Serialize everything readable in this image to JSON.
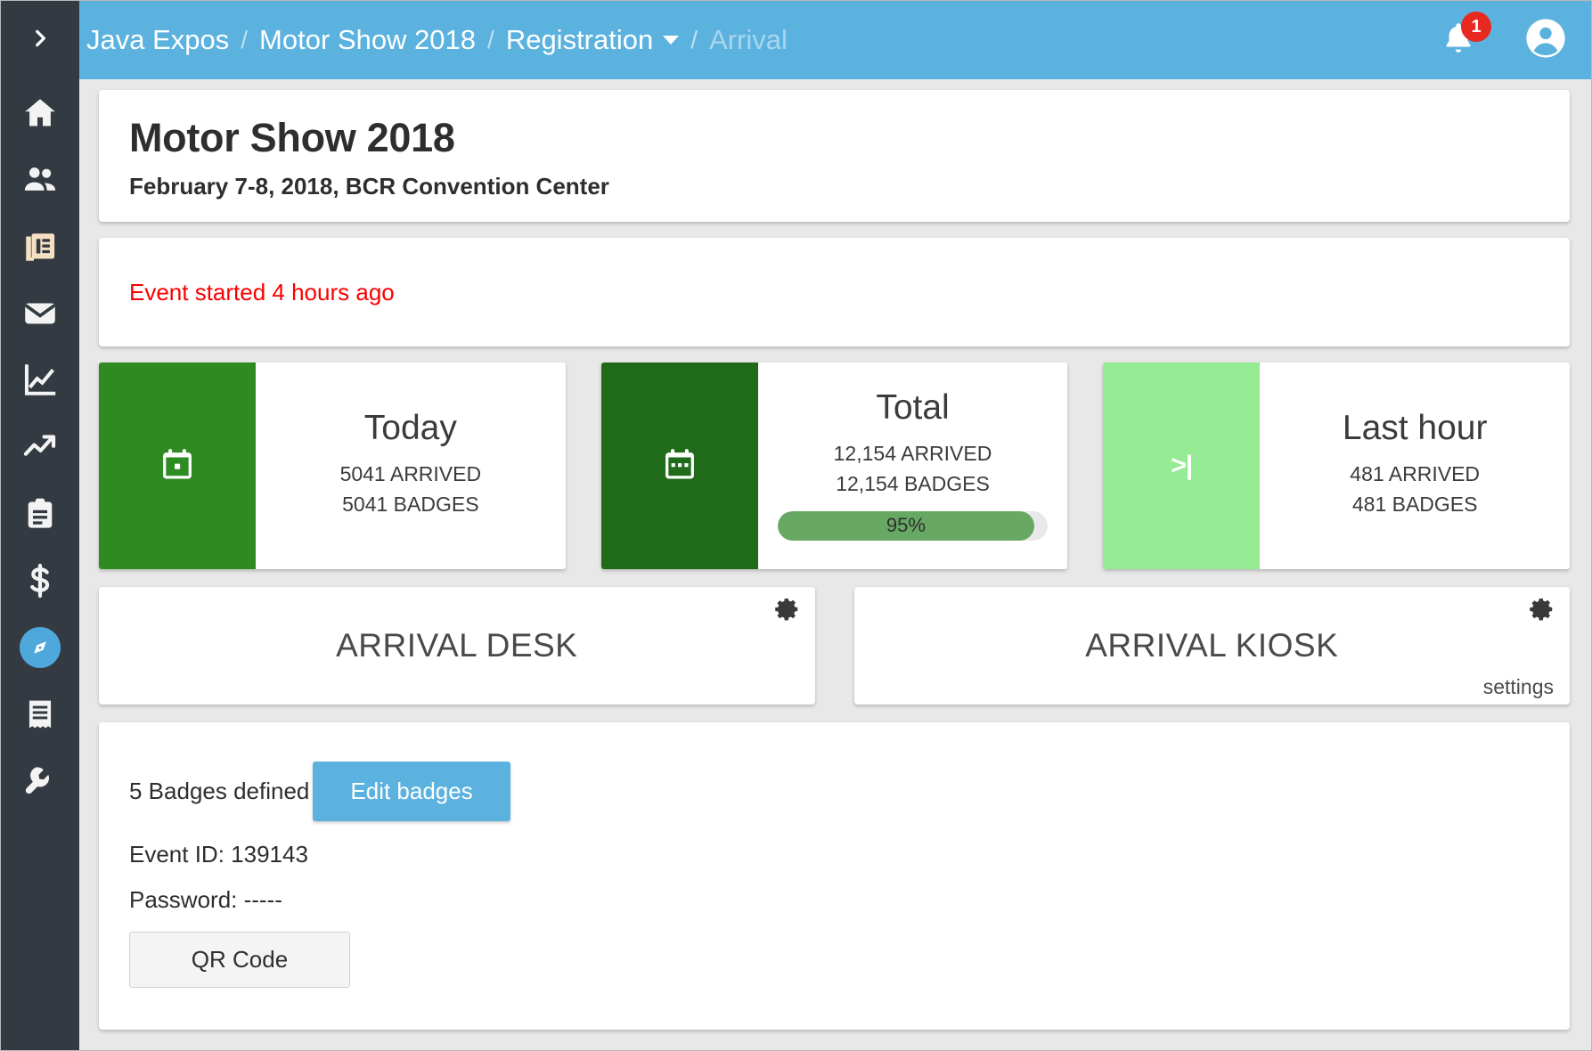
{
  "sidebar": {
    "toggle_icon": "chevron-right-icon",
    "items": [
      {
        "icon": "home-icon",
        "name": "home"
      },
      {
        "icon": "people-icon",
        "name": "people"
      },
      {
        "icon": "documents-icon",
        "name": "documents"
      },
      {
        "icon": "envelope-icon",
        "name": "messages"
      },
      {
        "icon": "chart-line-icon",
        "name": "reports"
      },
      {
        "icon": "trending-up-icon",
        "name": "trends"
      },
      {
        "icon": "clipboard-icon",
        "name": "tasks"
      },
      {
        "icon": "dollar-icon",
        "name": "finance"
      },
      {
        "icon": "compass-icon",
        "name": "registration"
      },
      {
        "icon": "receipt-icon",
        "name": "invoices"
      },
      {
        "icon": "wrench-icon",
        "name": "tools"
      }
    ]
  },
  "topbar": {
    "breadcrumb": [
      {
        "label": "Java Expos",
        "muted": false,
        "caret": false
      },
      {
        "label": "Motor Show 2018",
        "muted": false,
        "caret": false
      },
      {
        "label": "Registration",
        "muted": false,
        "caret": true
      },
      {
        "label": "Arrival",
        "muted": true,
        "caret": false
      }
    ],
    "separator": "/",
    "notifications_count": "1",
    "bell_icon": "bell-icon",
    "avatar_icon": "user-avatar-icon",
    "accent_color": "#5bb2de"
  },
  "event": {
    "title": "Motor Show 2018",
    "subtitle": "February 7-8, 2018, BCR Convention Center"
  },
  "alert": {
    "text": "Event started 4 hours ago",
    "color": "#fa0000"
  },
  "stats": [
    {
      "title": "Today",
      "arrived": "5041 ARRIVED",
      "badges": "5041 BADGES",
      "icon": "calendar-day-icon",
      "tile_color": "#2e8b22",
      "has_progress": false
    },
    {
      "title": "Total",
      "arrived": "12,154 ARRIVED",
      "badges": "12,154 BADGES",
      "icon": "calendar-range-icon",
      "tile_color": "#1f6b1a",
      "has_progress": true,
      "progress_label": "95%",
      "progress_percent": 95,
      "progress_color": "#67a962"
    },
    {
      "title": "Last hour",
      "arrived": "481 ARRIVED",
      "badges": "481 BADGES",
      "icon": "skip-next-icon",
      "icon_glyph": ">|",
      "tile_color": "#94eb94",
      "has_progress": false
    }
  ],
  "arrival_panels": [
    {
      "title": "ARRIVAL DESK",
      "gear_icon": "gear-icon",
      "settings_label": ""
    },
    {
      "title": "ARRIVAL KIOSK",
      "gear_icon": "gear-icon",
      "settings_label": "settings"
    }
  ],
  "bottom": {
    "badges_defined": "5 Badges defined",
    "edit_badges_label": "Edit badges",
    "event_id": "Event ID: 139143",
    "password": "Password: -----",
    "qr_label": "QR Code"
  }
}
